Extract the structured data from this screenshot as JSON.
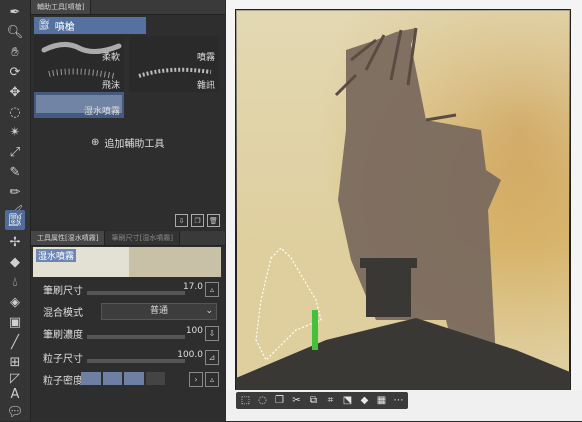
{
  "subtool_panel": {
    "tabs": [
      "輔助工具[噴槍]"
    ],
    "group_label": "噴槍",
    "brushes": [
      {
        "label": "柔軟",
        "selected": false
      },
      {
        "label": "噴霧",
        "selected": false
      },
      {
        "label": "飛沫",
        "selected": false
      },
      {
        "label": "雜訊",
        "selected": false
      },
      {
        "label": "湿水噴霧",
        "selected": true
      }
    ],
    "add_tool_label": "追加輔助工具",
    "footer_icons": [
      "download-icon",
      "copy-icon",
      "trash-icon"
    ]
  },
  "tool_property": {
    "tabs": [
      "工具属性[湿水噴霧]",
      "筆刷尺寸[湿水噴霧]"
    ],
    "preset_label": "湿水噴霧",
    "brush_size": {
      "label": "筆刷尺寸",
      "value": "17.0"
    },
    "blend_mode": {
      "label": "混合模式",
      "value": "普通"
    },
    "brush_density": {
      "label": "筆刷濃度",
      "value": "100"
    },
    "particle_size": {
      "label": "粒子尺寸",
      "value": "100.0"
    },
    "particle_density": {
      "label": "粒子密度"
    }
  },
  "toolbar": {
    "tools": [
      "pen-icon",
      "zoom-icon",
      "hand-icon",
      "rotate-icon",
      "move-icon",
      "lasso-icon",
      "magic-wand-icon",
      "eyedropper-icon",
      "pen-tool-icon",
      "pencil-icon",
      "brush-icon",
      "airbrush-icon",
      "decoration-icon",
      "eraser-icon",
      "blend-icon",
      "fill-icon",
      "gradient-icon",
      "line-icon",
      "frame-icon",
      "ruler-icon",
      "text-icon",
      "balloon-icon"
    ]
  },
  "canvas": {
    "bottom_icons": [
      "deselect-icon",
      "lasso-sel-icon",
      "copy-icon",
      "cut-icon",
      "paste-icon",
      "crop-icon",
      "transform-icon",
      "fill-sel-icon",
      "pattern-icon",
      "more-icon"
    ]
  },
  "colors": {
    "accent": "#5571a0",
    "panel": "#2e2e2e",
    "canvas_sky": "#d9b46b",
    "tower": "#7a6a5e",
    "roof": "#3a3835"
  }
}
